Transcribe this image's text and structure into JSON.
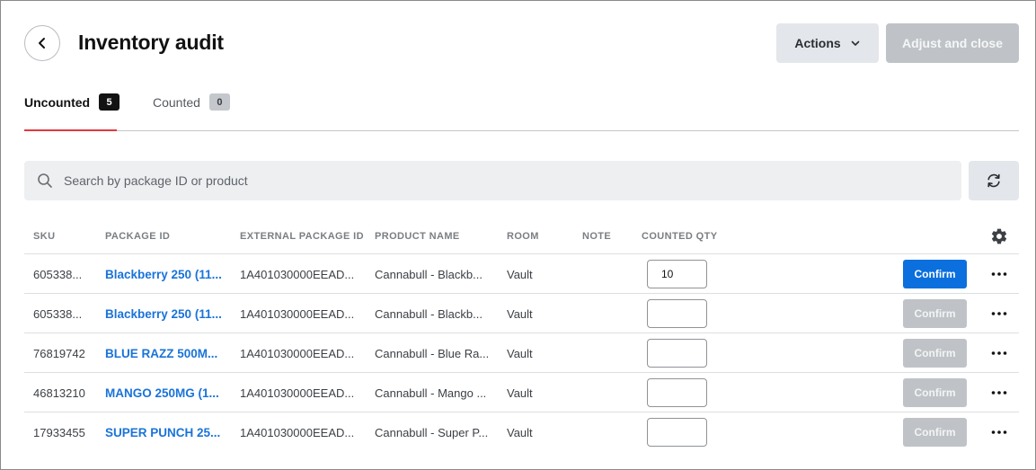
{
  "header": {
    "title": "Inventory audit",
    "actions_label": "Actions",
    "adjust_label": "Adjust and close"
  },
  "tabs": [
    {
      "label": "Uncounted",
      "count": "5",
      "active": true
    },
    {
      "label": "Counted",
      "count": "0",
      "active": false
    }
  ],
  "search": {
    "placeholder": "Search by package ID or product",
    "value": ""
  },
  "table": {
    "columns": [
      "SKU",
      "PACKAGE ID",
      "EXTERNAL PACKAGE ID",
      "PRODUCT NAME",
      "ROOM",
      "NOTE",
      "COUNTED QTY"
    ],
    "rows": [
      {
        "sku": "605338...",
        "package_id": "Blackberry 250 (11...",
        "external_package_id": "1A401030000EEAD...",
        "product_name": "Cannabull - Blackb...",
        "room": "Vault",
        "note": "",
        "counted_qty": "10",
        "confirm_label": "Confirm",
        "confirm_enabled": true
      },
      {
        "sku": "605338...",
        "package_id": "Blackberry 250 (11...",
        "external_package_id": "1A401030000EEAD...",
        "product_name": "Cannabull - Blackb...",
        "room": "Vault",
        "note": "",
        "counted_qty": "",
        "confirm_label": "Confirm",
        "confirm_enabled": false
      },
      {
        "sku": "76819742",
        "package_id": "BLUE RAZZ 500M...",
        "external_package_id": "1A401030000EEAD...",
        "product_name": "Cannabull - Blue Ra...",
        "room": "Vault",
        "note": "",
        "counted_qty": "",
        "confirm_label": "Confirm",
        "confirm_enabled": false
      },
      {
        "sku": "46813210",
        "package_id": "MANGO 250MG (1...",
        "external_package_id": "1A401030000EEAD...",
        "product_name": "Cannabull - Mango ...",
        "room": "Vault",
        "note": "",
        "counted_qty": "",
        "confirm_label": "Confirm",
        "confirm_enabled": false
      },
      {
        "sku": "17933455",
        "package_id": "SUPER PUNCH 25...",
        "external_package_id": "1A401030000EEAD...",
        "product_name": "Cannabull - Super P...",
        "room": "Vault",
        "note": "",
        "counted_qty": "",
        "confirm_label": "Confirm",
        "confirm_enabled": false
      }
    ]
  },
  "icons": {
    "back": "chevron-left-icon",
    "actions_dropdown": "chevron-down-icon",
    "search": "search-icon",
    "refresh": "refresh-icon",
    "settings": "gear-icon",
    "row_menu": "more-horizontal-icon"
  },
  "colors": {
    "primary": "#0b6fde",
    "link": "#1a73d9",
    "tab_indicator": "#e0393e",
    "disabled": "#bfc3c7"
  }
}
